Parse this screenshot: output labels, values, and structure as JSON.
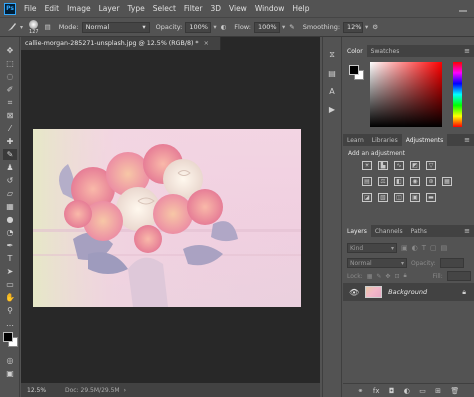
{
  "app": {
    "logo": "Ps"
  },
  "menu": [
    "File",
    "Edit",
    "Image",
    "Layer",
    "Type",
    "Select",
    "Filter",
    "3D",
    "View",
    "Window",
    "Help"
  ],
  "options": {
    "brush_size": "127",
    "mode_label": "Mode:",
    "mode_value": "Normal",
    "opacity_label": "Opacity:",
    "opacity_value": "100%",
    "flow_label": "Flow:",
    "flow_value": "100%",
    "smoothing_label": "Smoothing:",
    "smoothing_value": "12%"
  },
  "document": {
    "tab_title": "callie-morgan-285271-unsplash.jpg @ 12.5% (RGB/8) *",
    "close_glyph": "×",
    "zoom": "12.5%",
    "doc_info": "Doc: 29.5M/29.5M"
  },
  "color_panel": {
    "tabs": [
      "Color",
      "Swatches"
    ],
    "hue_base": "#ff0000",
    "foreground": "#000000",
    "background": "#ffffff"
  },
  "adjustments_panel": {
    "tabs": [
      "Learn",
      "Libraries",
      "Adjustments"
    ],
    "heading": "Add an adjustment"
  },
  "layers_panel": {
    "tabs": [
      "Layers",
      "Channels",
      "Paths"
    ],
    "kind_placeholder": "Kind",
    "blend_mode": "Normal",
    "opacity_label": "Opacity:",
    "lock_label": "Lock:",
    "fill_label": "Fill:",
    "layer_name": "Background"
  },
  "colors": {
    "accent_blue": "#31a8ff",
    "panel_bg": "#535353",
    "canvas_bg": "#282828"
  }
}
